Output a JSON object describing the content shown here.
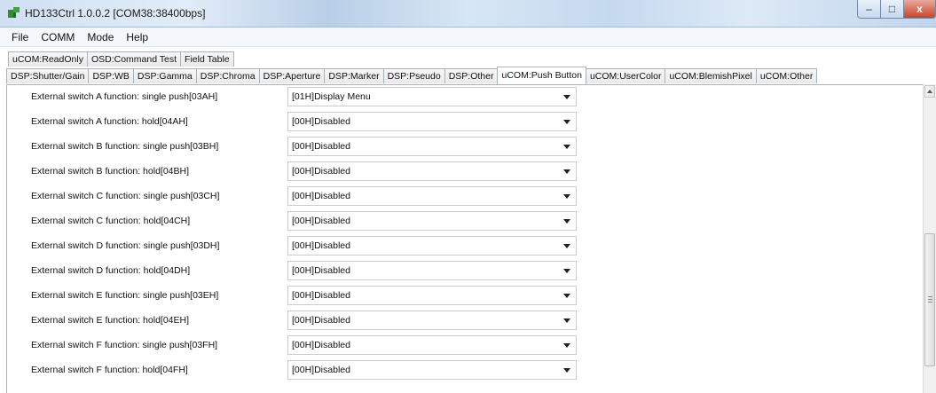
{
  "window": {
    "title": "HD133Ctrl 1.0.0.2 [COM38:38400bps]",
    "icon": "app-icon",
    "controls": {
      "minimize": "–",
      "maximize": "□",
      "close": "x"
    }
  },
  "menu": [
    "File",
    "COMM",
    "Mode",
    "Help"
  ],
  "tabs_row1": [
    "uCOM:ReadOnly",
    "OSD:Command Test",
    "Field Table"
  ],
  "tabs_row2": [
    "DSP:Shutter/Gain",
    "DSP:WB",
    "DSP:Gamma",
    "DSP:Chroma",
    "DSP:Aperture",
    "DSP:Marker",
    "DSP:Pseudo",
    "DSP:Other",
    "uCOM:Push Button",
    "uCOM:UserColor",
    "uCOM:BlemishPixel",
    "uCOM:Other"
  ],
  "active_tab": "uCOM:Push Button",
  "settings": [
    {
      "label": "External switch A function: single push[03AH]",
      "value": "[01H]Display Menu"
    },
    {
      "label": "External switch A function: hold[04AH]",
      "value": "[00H]Disabled"
    },
    {
      "label": "External switch B function: single push[03BH]",
      "value": "[00H]Disabled"
    },
    {
      "label": "External switch B function: hold[04BH]",
      "value": "[00H]Disabled"
    },
    {
      "label": "External switch C function: single push[03CH]",
      "value": "[00H]Disabled"
    },
    {
      "label": "External switch C function: hold[04CH]",
      "value": "[00H]Disabled"
    },
    {
      "label": "External switch D function: single push[03DH]",
      "value": "[00H]Disabled"
    },
    {
      "label": "External switch D function: hold[04DH]",
      "value": "[00H]Disabled"
    },
    {
      "label": "External switch E function: single push[03EH]",
      "value": "[00H]Disabled"
    },
    {
      "label": "External switch E function: hold[04EH]",
      "value": "[00H]Disabled"
    },
    {
      "label": "External switch F function: single push[03FH]",
      "value": "[00H]Disabled"
    },
    {
      "label": "External switch F function: hold[04FH]",
      "value": "[00H]Disabled"
    }
  ],
  "colors": {
    "title_accent": "#cfe0f2",
    "close_button": "#c8442b",
    "app_icon": "#2f8f2f"
  }
}
